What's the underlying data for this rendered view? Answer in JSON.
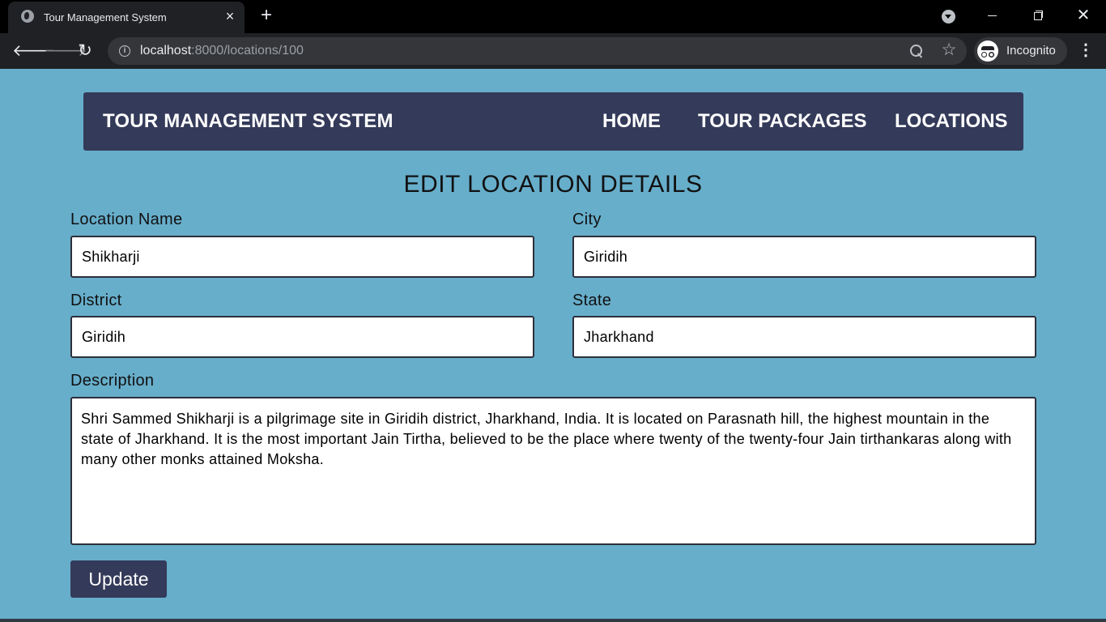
{
  "browser": {
    "tab_title": "Tour Management System",
    "url_host": "localhost",
    "url_path": ":8000/locations/100",
    "profile_label": "Incognito",
    "icons": [
      "globe-icon",
      "close-icon",
      "plus-icon",
      "tab-search-icon",
      "minimize-icon",
      "restore-icon",
      "window-close-icon",
      "back-arrow-icon",
      "forward-arrow-icon",
      "reload-icon",
      "info-icon",
      "zoom-icon",
      "star-icon",
      "incognito-icon",
      "more-vert-icon"
    ]
  },
  "navbar": {
    "brand": "TOUR MANAGEMENT SYSTEM",
    "links": [
      "HOME",
      "TOUR PACKAGES",
      "LOCATIONS"
    ],
    "background": "#343a59"
  },
  "form": {
    "title": "EDIT LOCATION DETAILS",
    "location_name": {
      "label": "Location Name",
      "value": "Shikharji"
    },
    "city": {
      "label": "City",
      "value": "Giridih"
    },
    "district": {
      "label": "District",
      "value": "Giridih"
    },
    "state": {
      "label": "State",
      "value": "Jharkhand"
    },
    "description": {
      "label": "Description",
      "value": "Shri Sammed Shikharji is a pilgrimage site in Giridih district, Jharkhand, India. It is located on Parasnath hill, the highest mountain in the state of Jharkhand. It is the most important Jain Tirtha, believed to be the place where twenty of the twenty-four Jain tirthankaras along with many other monks attained Moksha."
    },
    "submit_label": "Update"
  },
  "colors": {
    "page_background": "#67aecb",
    "accent": "#343a59"
  }
}
